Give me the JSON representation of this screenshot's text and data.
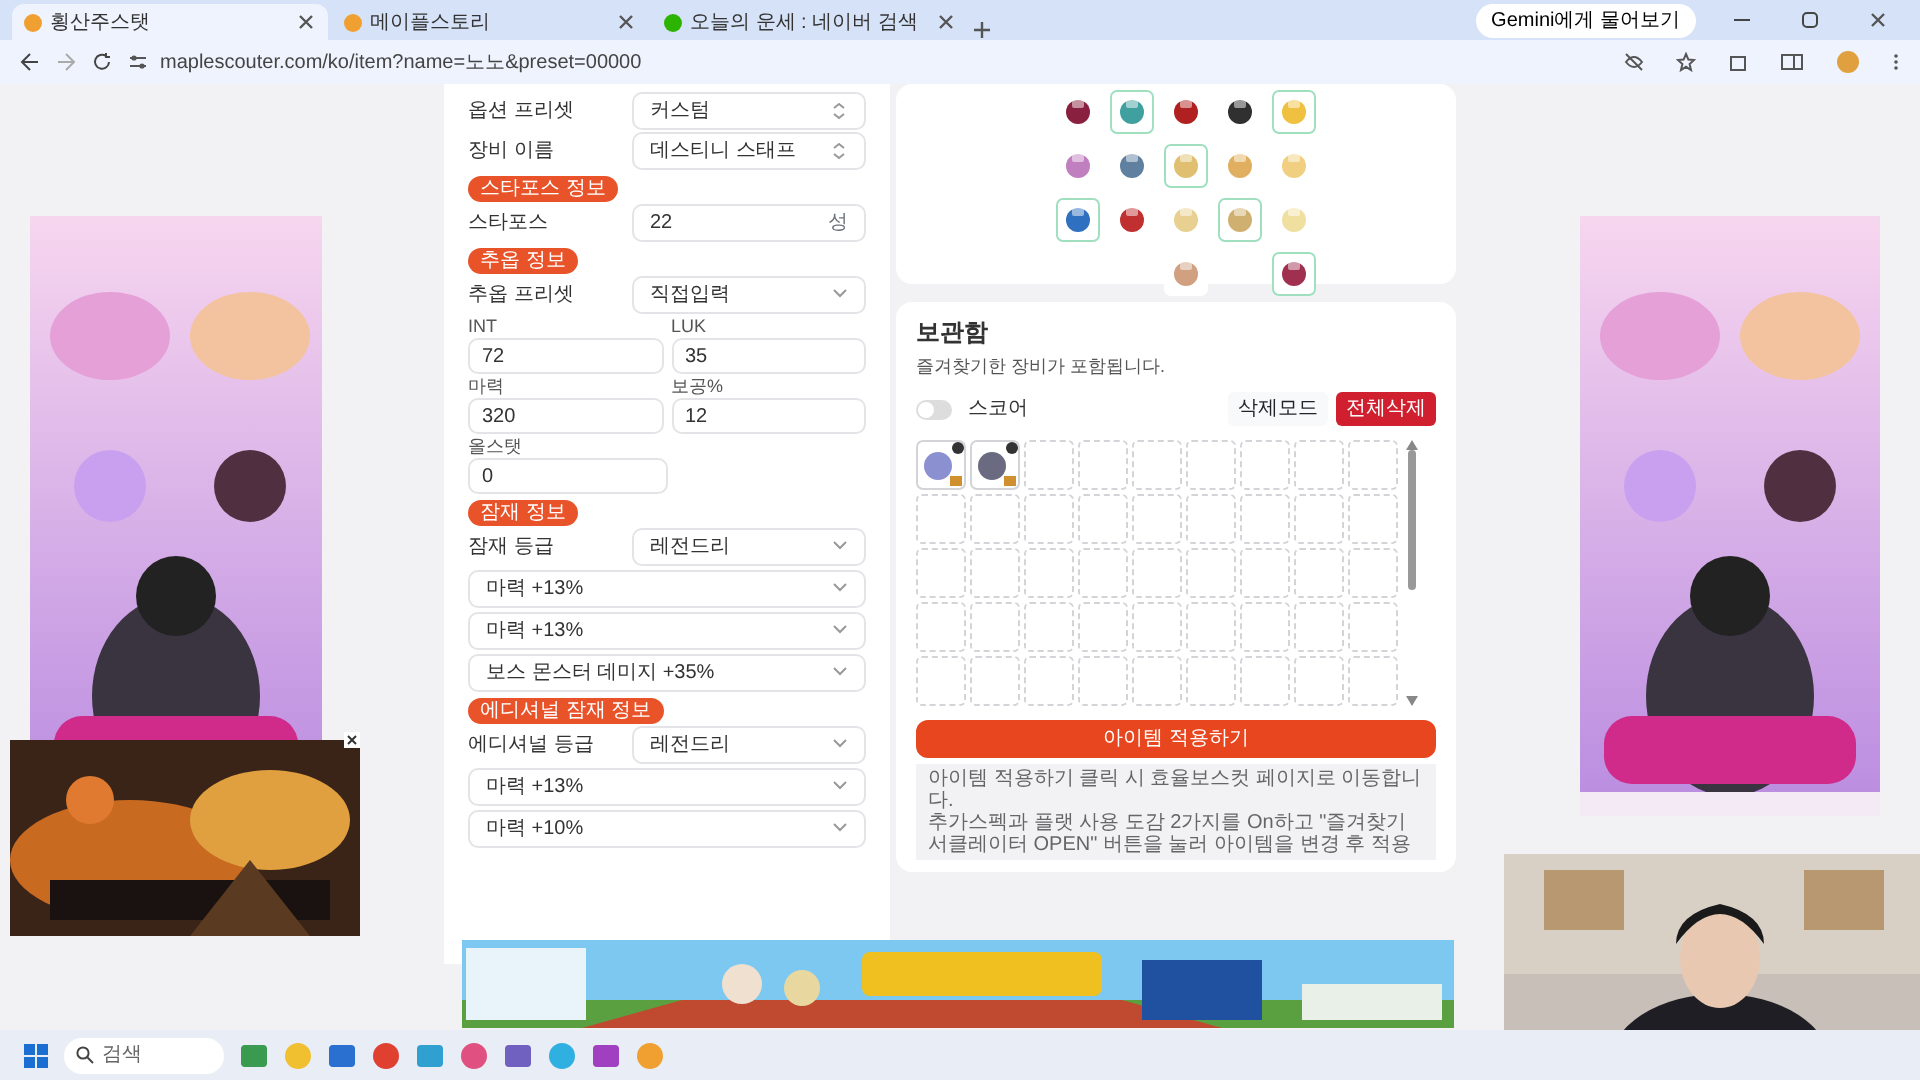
{
  "browser": {
    "tabs": [
      {
        "title": "횡산주스탯",
        "selected": true
      },
      {
        "title": "메이플스토리",
        "selected": false
      },
      {
        "title": "오늘의 운세 : 네이버 검색",
        "selected": false
      }
    ],
    "url": "maplescouter.com/ko/item?name=노노&preset=00000",
    "gemini_button": "Gemini에게 물어보기"
  },
  "form": [
    {
      "kind": "select",
      "label": "옵션 프리셋",
      "value": "커스텀"
    },
    {
      "kind": "select",
      "label": "장비 이름",
      "value": "데스티니 스태프"
    },
    {
      "kind": "badge",
      "label": "스타포스 정보"
    },
    {
      "kind": "input",
      "label": "스타포스",
      "value": "22",
      "suffix": "성"
    },
    {
      "kind": "badge",
      "label": "추옵 정보"
    },
    {
      "kind": "dropdown",
      "label": "추옵 프리셋",
      "value": "직접입력"
    },
    {
      "kind": "pair",
      "fields": [
        {
          "label": "INT",
          "value": "72"
        },
        {
          "label": "LUK",
          "value": "35"
        }
      ]
    },
    {
      "kind": "pair",
      "fields": [
        {
          "label": "마력",
          "value": "320"
        },
        {
          "label": "보공%",
          "value": "12"
        }
      ]
    },
    {
      "kind": "pair",
      "fields": [
        {
          "label": "올스탯",
          "value": "0"
        }
      ]
    },
    {
      "kind": "badge",
      "label": "잠재 정보"
    },
    {
      "kind": "dropdown",
      "label": "잠재 등급",
      "value": "레전드리"
    },
    {
      "kind": "option",
      "value": "마력 +13%"
    },
    {
      "kind": "option",
      "value": "마력 +13%"
    },
    {
      "kind": "option",
      "value": "보스 몬스터 데미지 +35%"
    },
    {
      "kind": "badge",
      "label": "에디셔널 잠재 정보"
    },
    {
      "kind": "dropdown",
      "label": "에디셔널 등급",
      "value": "레전드리"
    },
    {
      "kind": "option",
      "value": "마력 +13%"
    },
    {
      "kind": "option",
      "value": "마력 +10%"
    }
  ],
  "storage": {
    "title": "보관함",
    "subtitle": "즐겨찾기한 장비가 포함됩니다.",
    "toggle": {
      "label": "스코어",
      "on": false
    },
    "buttons": [
      {
        "label": "삭제모드",
        "kind": "plain"
      },
      {
        "label": "전체삭제",
        "kind": "danger"
      }
    ],
    "items": [
      {
        "kind": "item"
      },
      {
        "kind": "item"
      }
    ],
    "apply_button": "아이템 적용하기",
    "notes": [
      "아이템 적용하기 클릭 시 효율보스컷 페이지로 이동합니다.",
      "추가스펙과 플랫 사용 도감 2가지를 On하고 \"즐겨찾기 서클레이터 OPEN\" 버튼을 눌러 아이템을 변경 후 적용"
    ]
  },
  "taskbar": {
    "search_placeholder": "검색"
  }
}
